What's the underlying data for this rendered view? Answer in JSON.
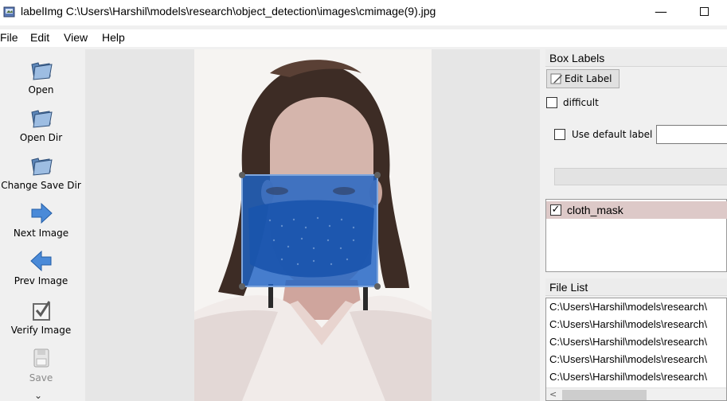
{
  "window": {
    "title": "labelImg C:\\Users\\Harshil\\models\\research\\object_detection\\images\\cmimage(9).jpg",
    "minimize_glyph": "—"
  },
  "menu": [
    "File",
    "Edit",
    "View",
    "Help"
  ],
  "toolbar": {
    "open": "Open",
    "open_dir": "Open Dir",
    "change_save_dir": "Change Save Dir",
    "next_image": "Next Image",
    "prev_image": "Prev Image",
    "verify_image": "Verify Image",
    "save": "Save",
    "more_glyph": "⌄"
  },
  "box_labels": {
    "header": "Box Labels",
    "edit_label_button": "Edit Label",
    "difficult_label": "difficult",
    "difficult_checked": false,
    "use_default_label": "Use default label",
    "use_default_checked": false,
    "default_label_value": "",
    "labels": [
      {
        "name": "cloth_mask",
        "checked": true,
        "check_glyph": "✓"
      }
    ]
  },
  "file_list": {
    "header": "File List",
    "files": [
      "C:\\Users\\Harshil\\models\\research\\",
      "C:\\Users\\Harshil\\models\\research\\",
      "C:\\Users\\Harshil\\models\\research\\",
      "C:\\Users\\Harshil\\models\\research\\",
      "C:\\Users\\Harshil\\models\\research\\"
    ],
    "scroll_left_glyph": "<"
  },
  "canvas": {
    "box_color": "#1f63c4",
    "vertex_color": "#606060"
  },
  "icons": {
    "open": "folder-open-icon",
    "open_dir": "folder-open-icon",
    "change_save_dir": "folder-open-icon",
    "next_image": "arrow-right-icon",
    "prev_image": "arrow-left-icon",
    "verify_image": "checkbox-icon",
    "save": "floppy-disk-icon",
    "edit_label": "pencil-icon"
  }
}
